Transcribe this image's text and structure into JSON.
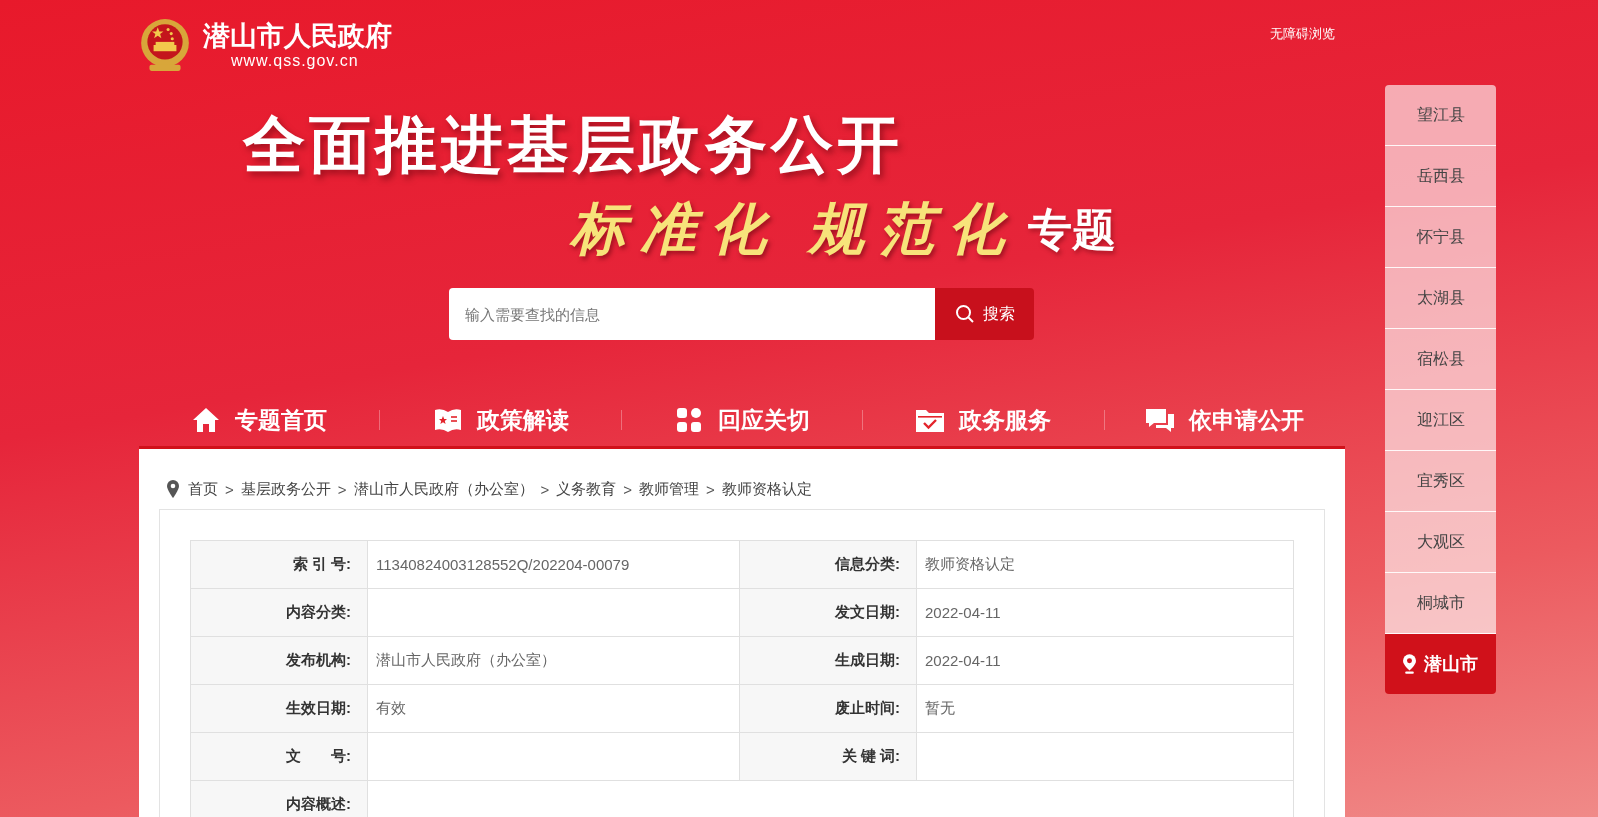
{
  "site": {
    "name": "潜山市人民政府",
    "url": "www.qss.gov.cn",
    "accessibility_link": "无障碍浏览"
  },
  "banner": {
    "title": "全面推进基层政务公开",
    "subtitle": "标准化 规范化",
    "subtitle_suffix": "专题"
  },
  "search": {
    "placeholder": "输入需要查找的信息",
    "button": "搜索"
  },
  "nav": [
    {
      "label": "专题首页",
      "kind": "home"
    },
    {
      "label": "政策解读",
      "kind": "book"
    },
    {
      "label": "回应关切",
      "kind": "grid"
    },
    {
      "label": "政务服务",
      "kind": "folder"
    },
    {
      "label": "依申请公开",
      "kind": "chat"
    }
  ],
  "breadcrumb": [
    {
      "kind": "link",
      "text": "首页"
    },
    {
      "kind": "separator",
      "text": ">"
    },
    {
      "kind": "link",
      "text": "基层政务公开"
    },
    {
      "kind": "separator",
      "text": ">"
    },
    {
      "kind": "link",
      "text": "潜山市人民政府（办公室）"
    },
    {
      "kind": "separator",
      "text": ">"
    },
    {
      "kind": "link",
      "text": "义务教育"
    },
    {
      "kind": "separator",
      "text": ">"
    },
    {
      "kind": "link",
      "text": "教师管理"
    },
    {
      "kind": "separator",
      "text": ">"
    },
    {
      "kind": "link",
      "text": "教师资格认定"
    }
  ],
  "info_table": [
    [
      {
        "label": "索 引 号:",
        "value": "11340824003128552Q/202204-00079"
      },
      {
        "label": "信息分类:",
        "value": "教师资格认定"
      }
    ],
    [
      {
        "label": "内容分类:"
      },
      {
        "label": "发文日期:",
        "value": "2022-04-11"
      }
    ],
    [
      {
        "label": "发布机构:",
        "value": "潜山市人民政府（办公室）"
      },
      {
        "label": "生成日期:",
        "value": "2022-04-11"
      }
    ],
    [
      {
        "label": "生效日期:",
        "value": "有效"
      },
      {
        "label": "废止时间:",
        "value": "暂无"
      }
    ],
    [
      {
        "label": "文　　号:"
      },
      {
        "label": "关 键 词:"
      }
    ],
    [
      {
        "label": "内容概述:"
      }
    ]
  ],
  "region_nav": [
    {
      "label": "望江县",
      "selected": false
    },
    {
      "label": "岳西县",
      "selected": false
    },
    {
      "label": "怀宁县",
      "selected": false
    },
    {
      "label": "太湖县",
      "selected": false
    },
    {
      "label": "宿松县",
      "selected": false
    },
    {
      "label": "迎江区",
      "selected": false
    },
    {
      "label": "宜秀区",
      "selected": false
    },
    {
      "label": "大观区",
      "selected": false
    },
    {
      "label": "桐城市",
      "selected": false
    },
    {
      "label": "潜山市",
      "selected": true
    }
  ]
}
